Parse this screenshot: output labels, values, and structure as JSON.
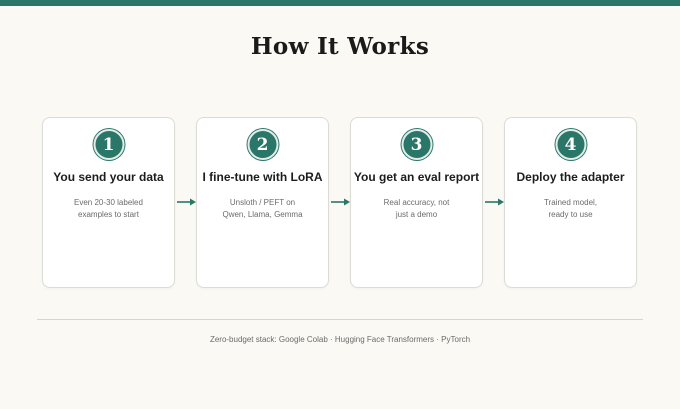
{
  "header": {
    "title": "How It Works"
  },
  "colors": {
    "accent": "#2a7668",
    "background": "#faf9f4",
    "card": "#ffffff"
  },
  "steps": [
    {
      "number": "1",
      "title": "You send your data",
      "desc_line1": "Even 20-30 labeled",
      "desc_line2": "examples to start"
    },
    {
      "number": "2",
      "title": "I fine-tune with LoRA",
      "desc_line1": "Unsloth / PEFT on",
      "desc_line2": "Qwen, Llama, Gemma"
    },
    {
      "number": "3",
      "title": "You get an eval report",
      "desc_line1": "Real accuracy, not",
      "desc_line2": "just a demo"
    },
    {
      "number": "4",
      "title": "Deploy the adapter",
      "desc_line1": "Trained model,",
      "desc_line2": "ready to use"
    }
  ],
  "arrow_icon": "arrow-right-icon",
  "footer": {
    "text": "Zero-budget stack: Google Colab · Hugging Face Transformers · PyTorch"
  }
}
